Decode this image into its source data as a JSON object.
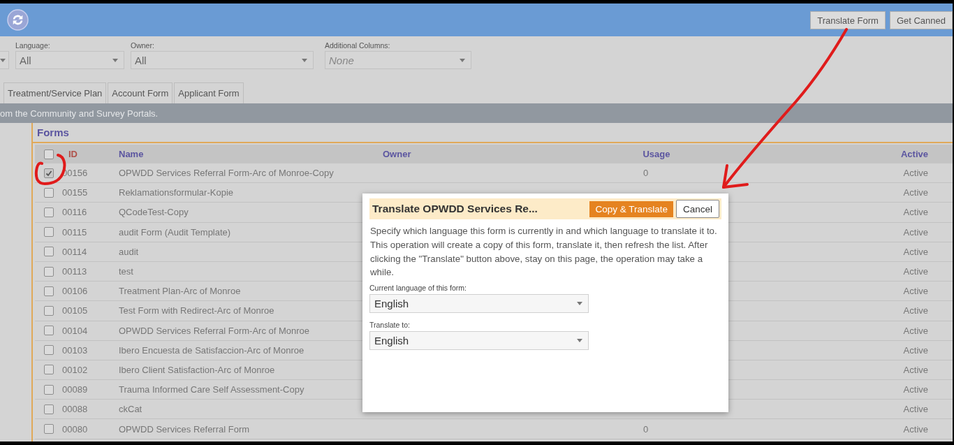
{
  "header": {
    "buttons": [
      "Translate Form",
      "Get Canned"
    ]
  },
  "filters": [
    {
      "label": "Language:",
      "value": "All"
    },
    {
      "label": "Owner:",
      "value": "All"
    },
    {
      "label": "Additional Columns:",
      "placeholder": "None"
    }
  ],
  "tabs": [
    {
      "label": "Treatment/Service Plan",
      "selected": false
    },
    {
      "label": "Account Form",
      "selected": false
    },
    {
      "label": "Applicant Form",
      "selected": false
    }
  ],
  "notice": "om the Community and Survey Portals.",
  "section_title": "Forms",
  "table": {
    "header_checked": false,
    "columns": [
      "ID",
      "Name",
      "Owner",
      "Usage",
      "Active"
    ],
    "rows": [
      {
        "checked": true,
        "id": "00156",
        "name": "OPWDD Services Referral Form-Arc of Monroe-Copy",
        "usage": "0",
        "active": "Active"
      },
      {
        "checked": false,
        "id": "00155",
        "name": "Reklamationsformular-Kopie",
        "active": "Active"
      },
      {
        "checked": false,
        "id": "00116",
        "name": "QCodeTest-Copy",
        "active": "Active"
      },
      {
        "checked": false,
        "id": "00115",
        "name": "audit Form (Audit Template)",
        "active": "Active"
      },
      {
        "checked": false,
        "id": "00114",
        "name": "audit",
        "active": "Active"
      },
      {
        "checked": false,
        "id": "00113",
        "name": "test",
        "active": "Active"
      },
      {
        "checked": false,
        "id": "00106",
        "name": "Treatment Plan-Arc of Monroe",
        "active": "Active"
      },
      {
        "checked": false,
        "id": "00105",
        "name": "Test Form with Redirect-Arc of Monroe",
        "active": "Active"
      },
      {
        "checked": false,
        "id": "00104",
        "name": "OPWDD Services Referral Form-Arc of Monroe",
        "active": "Active"
      },
      {
        "checked": false,
        "id": "00103",
        "name": "Ibero Encuesta de Satisfaccion-Arc of Monroe",
        "active": "Active"
      },
      {
        "checked": false,
        "id": "00102",
        "name": "Ibero Client Satisfaction-Arc of Monroe",
        "active": "Active"
      },
      {
        "checked": false,
        "id": "00089",
        "name": "Trauma Informed Care Self Assessment-Copy",
        "active": "Active"
      },
      {
        "checked": false,
        "id": "00088",
        "name": "ckCat",
        "active": "Active"
      },
      {
        "checked": false,
        "id": "00080",
        "name": "OPWDD Services Referral Form",
        "usage": "0",
        "active": "Active"
      }
    ]
  },
  "dialog": {
    "title": "Translate OPWDD Services Re...",
    "primary_button": "Copy & Translate",
    "cancel_button": "Cancel",
    "description": "Specify which language this form is currently in and which language to translate it to. This operation will create a copy of this form, translate it, then refresh the list. After clicking the \"Translate\" button above, stay on this page, the operation may take a while.",
    "fields": [
      {
        "label": "Current language of this form:",
        "value": "English"
      },
      {
        "label": "Translate to:",
        "value": "English"
      }
    ]
  }
}
